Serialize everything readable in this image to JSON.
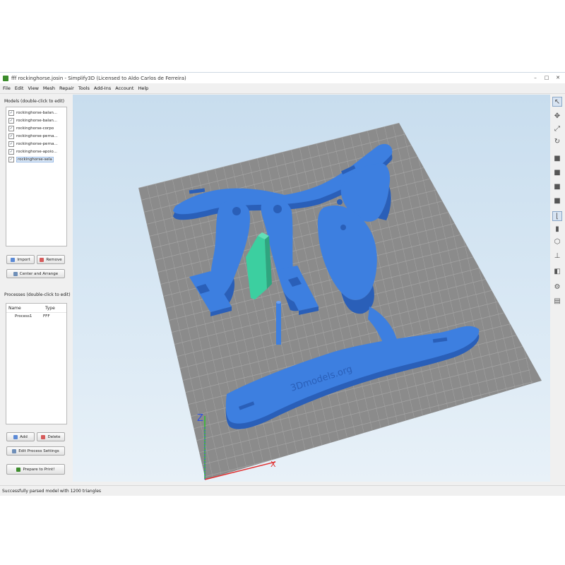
{
  "window": {
    "title": "fff rockinghorse.josin - Simplify3D (Licensed to Aldo Carlos de Ferreira)",
    "controls": [
      "–",
      "□",
      "✕"
    ]
  },
  "menu": [
    "File",
    "Edit",
    "View",
    "Mesh",
    "Repair",
    "Tools",
    "Add-Ins",
    "Account",
    "Help"
  ],
  "models": {
    "header": "Models (double-click to edit)",
    "items": [
      {
        "label": "rockinghorse-balan...",
        "checked": "✓"
      },
      {
        "label": "rockinghorse-balan...",
        "checked": "✓"
      },
      {
        "label": "rockinghorse-corpo",
        "checked": "✓"
      },
      {
        "label": "rockinghorse-perna...",
        "checked": "✓"
      },
      {
        "label": "rockinghorse-perna...",
        "checked": "✓"
      },
      {
        "label": "rockinghorse-apoio...",
        "checked": "✓"
      },
      {
        "label": "rockinghorse-sela",
        "checked": "✓"
      }
    ],
    "import_label": "Import",
    "remove_label": "Remove",
    "center_label": "Center and Arrange"
  },
  "processes": {
    "header": "Processes (double-click to edit)",
    "columns": [
      "Name",
      "Type"
    ],
    "rows": [
      {
        "name": "Process1",
        "type": "FFF"
      }
    ],
    "add_label": "Add",
    "delete_label": "Delete",
    "edit_label": "Edit Process Settings",
    "prepare_label": "Prepare to Print!"
  },
  "viewport": {
    "axis_z": "Z",
    "axis_x": "X",
    "engraving": "3Dmodels.org"
  },
  "colors": {
    "model_blue": "#3d7fe0",
    "model_blue_dark": "#2a5fb8",
    "model_green": "#3ccfa0",
    "bed": "#8c8c8c",
    "grid": "#b1b1b1",
    "sky": "#cfe2f2"
  },
  "toolbar_icons": [
    "select-cursor-icon",
    "move-icon",
    "scale-icon",
    "rotate-icon",
    "view-default-icon",
    "view-front-icon",
    "view-side-icon",
    "view-top-icon",
    "axis-toggle-icon",
    "solid-view-icon",
    "wireframe-icon",
    "section-icon",
    "cut-plane-icon",
    "settings-gear-icon",
    "layer-view-icon"
  ],
  "status": "Successfully parsed model with 1200 triangles"
}
